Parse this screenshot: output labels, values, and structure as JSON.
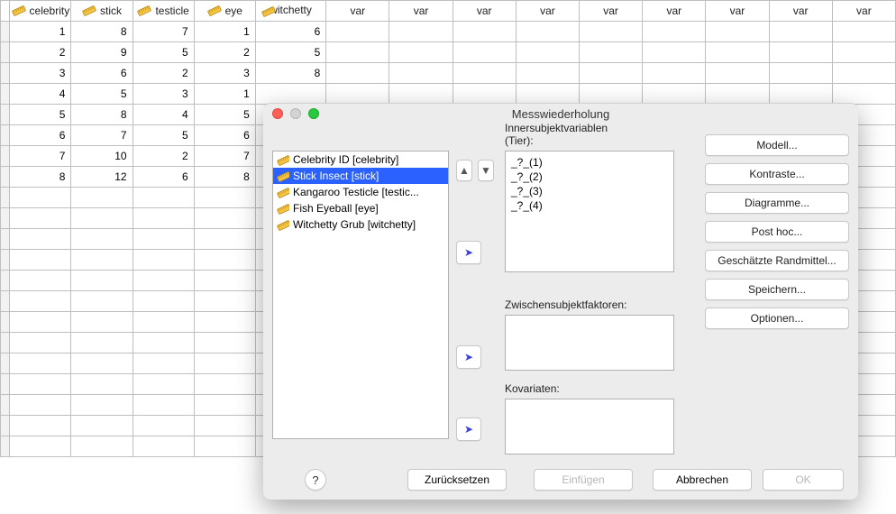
{
  "sheet": {
    "columns": [
      "celebrity",
      "stick",
      "testicle",
      "eye",
      "witchetty"
    ],
    "rows": [
      [
        1,
        8,
        7,
        1,
        6
      ],
      [
        2,
        9,
        5,
        2,
        5
      ],
      [
        3,
        6,
        2,
        3,
        8
      ],
      [
        4,
        5,
        3,
        1,
        null
      ],
      [
        5,
        8,
        4,
        5,
        null
      ],
      [
        6,
        7,
        5,
        6,
        null
      ],
      [
        7,
        10,
        2,
        7,
        null
      ],
      [
        8,
        12,
        6,
        8,
        null
      ]
    ],
    "var_placeholder": "var"
  },
  "dialog": {
    "title": "Messwiederholung",
    "vars": [
      {
        "label": "Celebrity ID [celebrity]",
        "selected": false
      },
      {
        "label": "Stick Insect [stick]",
        "selected": true
      },
      {
        "label": "Kangaroo Testicle [testic...",
        "selected": false
      },
      {
        "label": "Fish Eyeball [eye]",
        "selected": false
      },
      {
        "label": "Witchetty Grub [witchetty]",
        "selected": false
      }
    ],
    "inner_label_line1": "Innersubjektvariablen",
    "inner_label_line2": "(Tier):",
    "inner_items": [
      "_?_(1)",
      "_?_(2)",
      "_?_(3)",
      "_?_(4)"
    ],
    "between_label": "Zwischensubjektfaktoren:",
    "covar_label": "Kovariaten:",
    "right_buttons": [
      "Modell...",
      "Kontraste...",
      "Diagramme...",
      "Post hoc...",
      "Geschätzte Randmittel...",
      "Speichern...",
      "Optionen..."
    ],
    "bottom": {
      "help": "?",
      "reset": "Zurücksetzen",
      "paste": "Einfügen",
      "cancel": "Abbrechen",
      "ok": "OK"
    }
  }
}
